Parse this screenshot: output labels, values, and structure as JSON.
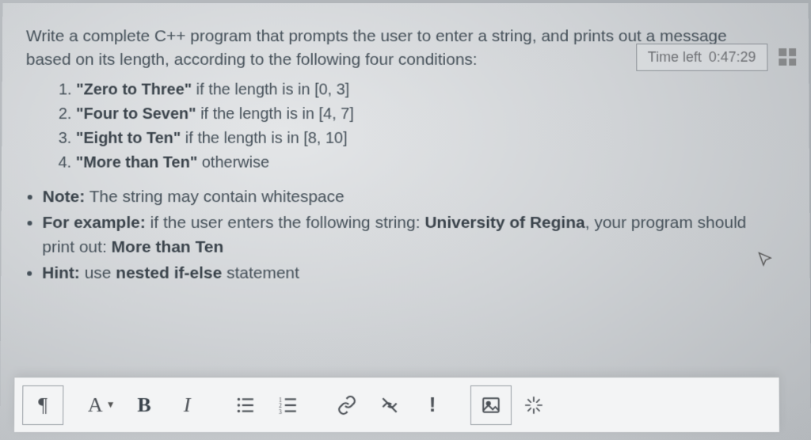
{
  "timer": {
    "label": "Time left",
    "value": "0:47:29"
  },
  "question": {
    "intro": "Write a complete C++ program that prompts the user to enter a string, and prints out a message based on its length, according to the following four conditions:",
    "conditions": [
      {
        "bold": "\"Zero to Three\"",
        "rest": " if the length is in [0, 3]"
      },
      {
        "bold": "\"Four to Seven\"",
        "rest": " if the length is in [4, 7]"
      },
      {
        "bold": "\"Eight to Ten\"",
        "rest": " if the length is in [8, 10]"
      },
      {
        "bold": "\"More than Ten\"",
        "rest": " otherwise"
      }
    ],
    "note_label": "Note:",
    "note_text": " The string may contain whitespace",
    "example_label": "For example:",
    "example_prefix": " if the user enters the following string: ",
    "example_input": "University of Regina",
    "example_suffix": ", your program should print out: ",
    "example_output": "More than Ten",
    "hint_label": "Hint:",
    "hint_prefix": " use ",
    "hint_bold": "nested if-else",
    "hint_suffix": " statement"
  },
  "toolbar": {
    "paragraph": "¶",
    "font": "A",
    "bold": "B",
    "italic": "I",
    "alert": "!"
  }
}
